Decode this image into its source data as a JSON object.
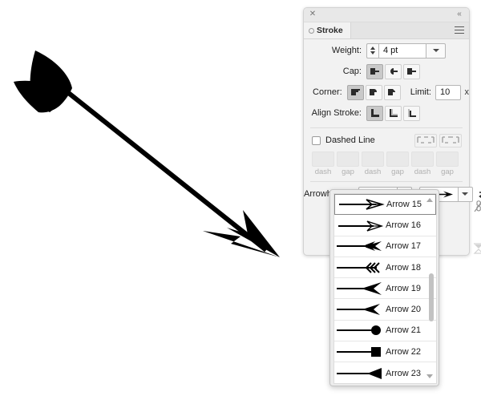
{
  "panel": {
    "titlebar": {
      "close_icon": "close-icon",
      "collapse_icon": "double-chevron-left-icon"
    },
    "tab_label": "Stroke",
    "menu_icon": "hamburger-menu-icon",
    "weight": {
      "label": "Weight:",
      "value": "4 pt",
      "stepper_icon": "stepper-updown-icon",
      "dropdown_icon": "chevron-down-icon"
    },
    "cap": {
      "label": "Cap:",
      "options": [
        "butt-cap-icon",
        "round-cap-icon",
        "projecting-cap-icon"
      ],
      "selected_index": 0
    },
    "corner": {
      "label": "Corner:",
      "options": [
        "miter-join-icon",
        "round-join-icon",
        "bevel-join-icon"
      ],
      "selected_index": 0
    },
    "limit": {
      "label": "Limit:",
      "value": "10",
      "unit": "x"
    },
    "align_stroke": {
      "label": "Align Stroke:",
      "options": [
        "align-center-icon",
        "align-inside-icon",
        "align-outside-icon"
      ],
      "selected_index": 0
    },
    "dashed_line": {
      "label": "Dashed Line",
      "checked": false,
      "cap_buttons": [
        "dash-preserve-icon",
        "dash-adjust-icon"
      ],
      "fields": [
        "",
        "",
        "",
        "",
        "",
        ""
      ],
      "field_labels": [
        "dash",
        "gap",
        "dash",
        "gap",
        "dash",
        "gap"
      ]
    },
    "arrowheads": {
      "label": "Arrowheads:",
      "start_icon": "fletching-arrow-icon",
      "end_icon": "simple-arrow-icon",
      "dropdown_icon": "chevron-down-icon",
      "swap_icon": "swap-arrowheads-icon"
    },
    "rail": {
      "swap_icon": "swap-arrowheads-icon",
      "link_broken_icon": "link-broken-icon",
      "scale_profile_icon": "scale-profile-icon"
    }
  },
  "arrow_menu": {
    "scroll_up_icon": "caret-up-icon",
    "scroll_down_icon": "caret-down-icon",
    "selected_index": 0,
    "items": [
      {
        "label": "Arrow 15",
        "glyph": "arrow-barbed-open-icon"
      },
      {
        "label": "Arrow 16",
        "glyph": "arrow-barbed-thin-icon"
      },
      {
        "label": "Arrow 17",
        "glyph": "arrow-fletched-icon"
      },
      {
        "label": "Arrow 18",
        "glyph": "arrow-triple-chevron-icon"
      },
      {
        "label": "Arrow 19",
        "glyph": "arrow-swallowtail-icon"
      },
      {
        "label": "Arrow 20",
        "glyph": "arrow-notched-icon"
      },
      {
        "label": "Arrow 21",
        "glyph": "arrow-circle-icon"
      },
      {
        "label": "Arrow 22",
        "glyph": "arrow-square-icon"
      },
      {
        "label": "Arrow 23",
        "glyph": "arrow-solid-triangle-icon"
      }
    ]
  },
  "canvas": {
    "artwork_name": "arrow-illustration",
    "stroke_color": "#000000"
  }
}
